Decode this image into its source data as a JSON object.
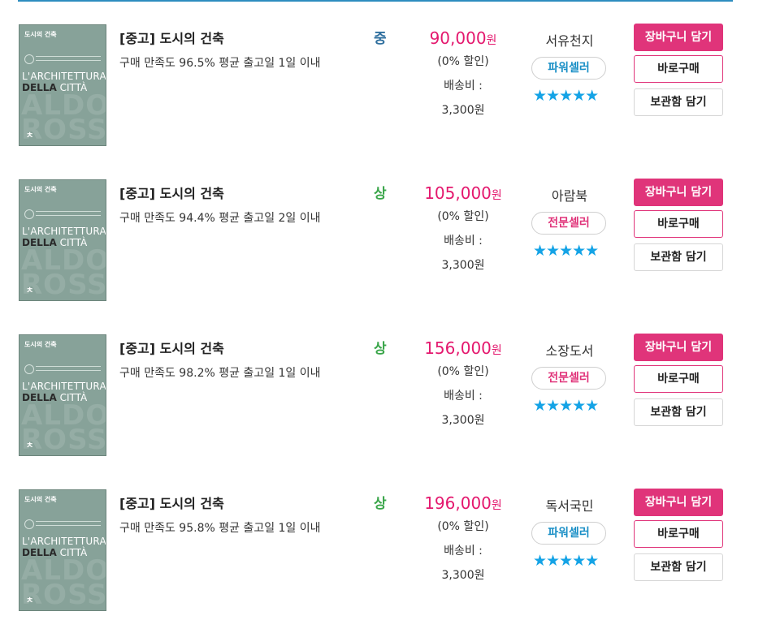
{
  "theme": {
    "accent": "#e0347a",
    "price_color": "#e4186e",
    "star_color": "#14a3e6",
    "top_rule": "#2d8dbf"
  },
  "listings": [
    {
      "cover": {
        "head": "도시의 건축",
        "line1": "L'ARCHITETTURA",
        "line2a": "DELLA",
        "line2b": "CITTÀ",
        "big": "ALDO ROSSI",
        "logo": "ㅊ"
      },
      "title": "[중고] 도시의 건축",
      "meta": "구매 만족도 96.5%    평균 출고일 1일 이내",
      "condition": "중",
      "condition_color": "#2f6f9e",
      "price": "90,000",
      "price_unit": "원",
      "discount": "(0% 할인)",
      "shipping_label": "배송비 :",
      "shipping_value": "3,300원",
      "seller": "서유천지",
      "badge": "파워셀러",
      "badge_color": "#1a8fc6",
      "stars": "★★★★★",
      "cart_label": "장바구니 담기",
      "buy_label": "바로구매",
      "save_label": "보관함 담기"
    },
    {
      "cover": {
        "head": "도시의 건축",
        "line1": "L'ARCHITETTURA",
        "line2a": "DELLA",
        "line2b": "CITTÀ",
        "big": "ALDO ROSSI",
        "logo": "ㅊ"
      },
      "title": "[중고] 도시의 건축",
      "meta": "구매 만족도 94.4%    평균 출고일 2일 이내",
      "condition": "상",
      "condition_color": "#3aa64a",
      "price": "105,000",
      "price_unit": "원",
      "discount": "(0% 할인)",
      "shipping_label": "배송비 :",
      "shipping_value": "3,300원",
      "seller": "아람북",
      "badge": "전문셀러",
      "badge_color": "#e0347a",
      "stars": "★★★★★",
      "cart_label": "장바구니 담기",
      "buy_label": "바로구매",
      "save_label": "보관함 담기"
    },
    {
      "cover": {
        "head": "도시의 건축",
        "line1": "L'ARCHITETTURA",
        "line2a": "DELLA",
        "line2b": "CITTÀ",
        "big": "ALDO ROSSI",
        "logo": "ㅊ"
      },
      "title": "[중고] 도시의 건축",
      "meta": "구매 만족도 98.2%    평균 출고일 1일 이내",
      "condition": "상",
      "condition_color": "#3aa64a",
      "price": "156,000",
      "price_unit": "원",
      "discount": "(0% 할인)",
      "shipping_label": "배송비 :",
      "shipping_value": "3,300원",
      "seller": "소장도서",
      "badge": "전문셀러",
      "badge_color": "#e0347a",
      "stars": "★★★★★",
      "cart_label": "장바구니 담기",
      "buy_label": "바로구매",
      "save_label": "보관함 담기"
    },
    {
      "cover": {
        "head": "도시의 건축",
        "line1": "L'ARCHITETTURA",
        "line2a": "DELLA",
        "line2b": "CITTÀ",
        "big": "ALDO ROSSI",
        "logo": "ㅊ"
      },
      "title": "[중고] 도시의 건축",
      "meta": "구매 만족도 95.8%    평균 출고일 1일 이내",
      "condition": "상",
      "condition_color": "#3aa64a",
      "price": "196,000",
      "price_unit": "원",
      "discount": "(0% 할인)",
      "shipping_label": "배송비 :",
      "shipping_value": "3,300원",
      "seller": "독서국민",
      "badge": "파워셀러",
      "badge_color": "#1a8fc6",
      "stars": "★★★★★",
      "cart_label": "장바구니 담기",
      "buy_label": "바로구매",
      "save_label": "보관함 담기"
    }
  ]
}
